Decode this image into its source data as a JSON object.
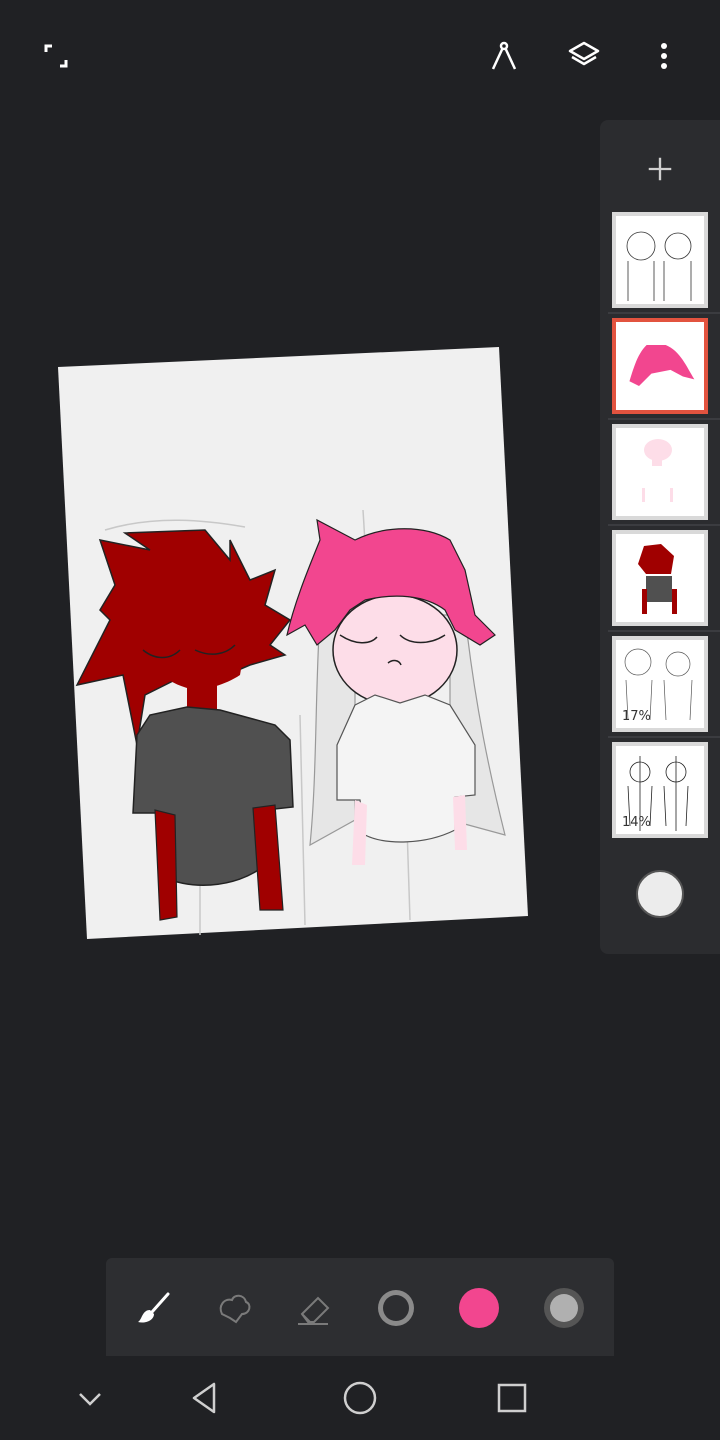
{
  "app": {
    "icons": {
      "fullscreen": "fullscreen-icon",
      "ruler": "ruler-compass-icon",
      "layers": "layers-icon",
      "more": "more-vert-icon"
    }
  },
  "layers_panel": {
    "add_icon": "plus-icon",
    "layers": [
      {
        "name": "sketch-top",
        "opacity_label": "",
        "selected": false
      },
      {
        "name": "pink-hair",
        "opacity_label": "",
        "selected": true
      },
      {
        "name": "pink-skin",
        "opacity_label": "",
        "selected": false
      },
      {
        "name": "red-character",
        "opacity_label": "",
        "selected": false
      },
      {
        "name": "sketch-17",
        "opacity_label": "17%",
        "selected": false
      },
      {
        "name": "sketch-14",
        "opacity_label": "14%",
        "selected": false
      }
    ],
    "background_color": "#ececec"
  },
  "toolbar": {
    "tools": [
      "brush-icon",
      "smudge-icon",
      "eraser-icon",
      "brush-size-icon",
      "color-icon",
      "opacity-icon"
    ],
    "active_color": "#f2468f"
  },
  "colors": {
    "background": "#202124",
    "panel": "#2b2c2f",
    "selected_layer": "#e2533f",
    "hair_pink": "#f2468f",
    "skin_pink": "#fddde8",
    "red": "#a00000",
    "shirt": "#505050"
  },
  "nav": {
    "icons": [
      "chevron-down-icon",
      "back-icon",
      "home-icon",
      "recents-icon"
    ]
  }
}
